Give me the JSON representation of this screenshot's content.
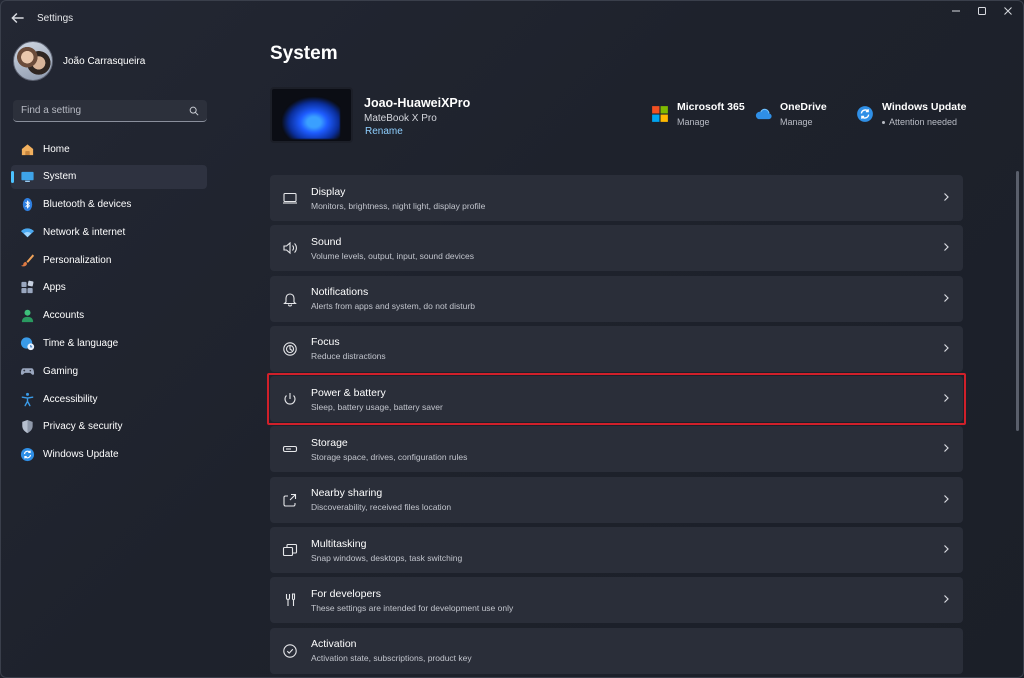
{
  "window": {
    "title": "Settings"
  },
  "profile": {
    "name": "João Carrasqueira"
  },
  "search": {
    "placeholder": "Find a setting"
  },
  "sidebar": {
    "items": [
      {
        "label": "Home",
        "icon": "home-icon",
        "active": false
      },
      {
        "label": "System",
        "icon": "monitor-icon",
        "active": true
      },
      {
        "label": "Bluetooth & devices",
        "icon": "bluetooth-icon",
        "active": false
      },
      {
        "label": "Network & internet",
        "icon": "wifi-icon",
        "active": false
      },
      {
        "label": "Personalization",
        "icon": "paintbrush-icon",
        "active": false
      },
      {
        "label": "Apps",
        "icon": "apps-icon",
        "active": false
      },
      {
        "label": "Accounts",
        "icon": "person-icon",
        "active": false
      },
      {
        "label": "Time & language",
        "icon": "globe-clock-icon",
        "active": false
      },
      {
        "label": "Gaming",
        "icon": "gamepad-icon",
        "active": false
      },
      {
        "label": "Accessibility",
        "icon": "accessibility-icon",
        "active": false
      },
      {
        "label": "Privacy & security",
        "icon": "shield-icon",
        "active": false
      },
      {
        "label": "Windows Update",
        "icon": "update-icon",
        "active": false
      }
    ]
  },
  "main": {
    "title": "System",
    "device": {
      "name": "Joao-HuaweiXPro",
      "model": "MateBook X Pro",
      "rename_label": "Rename"
    },
    "quick_links": [
      {
        "title": "Microsoft 365",
        "subtitle": "Manage",
        "icon": "microsoft-365-icon"
      },
      {
        "title": "OneDrive",
        "subtitle": "Manage",
        "icon": "onedrive-icon"
      },
      {
        "title": "Windows Update",
        "subtitle": "Attention needed",
        "icon": "windows-update-icon"
      }
    ],
    "settings": [
      {
        "title": "Display",
        "description": "Monitors, brightness, night light, display profile",
        "icon": "display-icon"
      },
      {
        "title": "Sound",
        "description": "Volume levels, output, input, sound devices",
        "icon": "speaker-icon"
      },
      {
        "title": "Notifications",
        "description": "Alerts from apps and system, do not disturb",
        "icon": "bell-icon"
      },
      {
        "title": "Focus",
        "description": "Reduce distractions",
        "icon": "focus-icon"
      },
      {
        "title": "Power & battery",
        "description": "Sleep, battery usage, battery saver",
        "icon": "power-icon",
        "highlighted": true
      },
      {
        "title": "Storage",
        "description": "Storage space, drives, configuration rules",
        "icon": "storage-icon"
      },
      {
        "title": "Nearby sharing",
        "description": "Discoverability, received files location",
        "icon": "share-icon"
      },
      {
        "title": "Multitasking",
        "description": "Snap windows, desktops, task switching",
        "icon": "multitasking-icon"
      },
      {
        "title": "For developers",
        "description": "These settings are intended for development use only",
        "icon": "developer-tools-icon"
      },
      {
        "title": "Activation",
        "description": "Activation state, subscriptions, product key",
        "icon": "check-circle-icon"
      }
    ]
  },
  "colors": {
    "accent": "#4cc2ff",
    "highlight_border": "#d0202a",
    "card": "#2a2e39"
  }
}
